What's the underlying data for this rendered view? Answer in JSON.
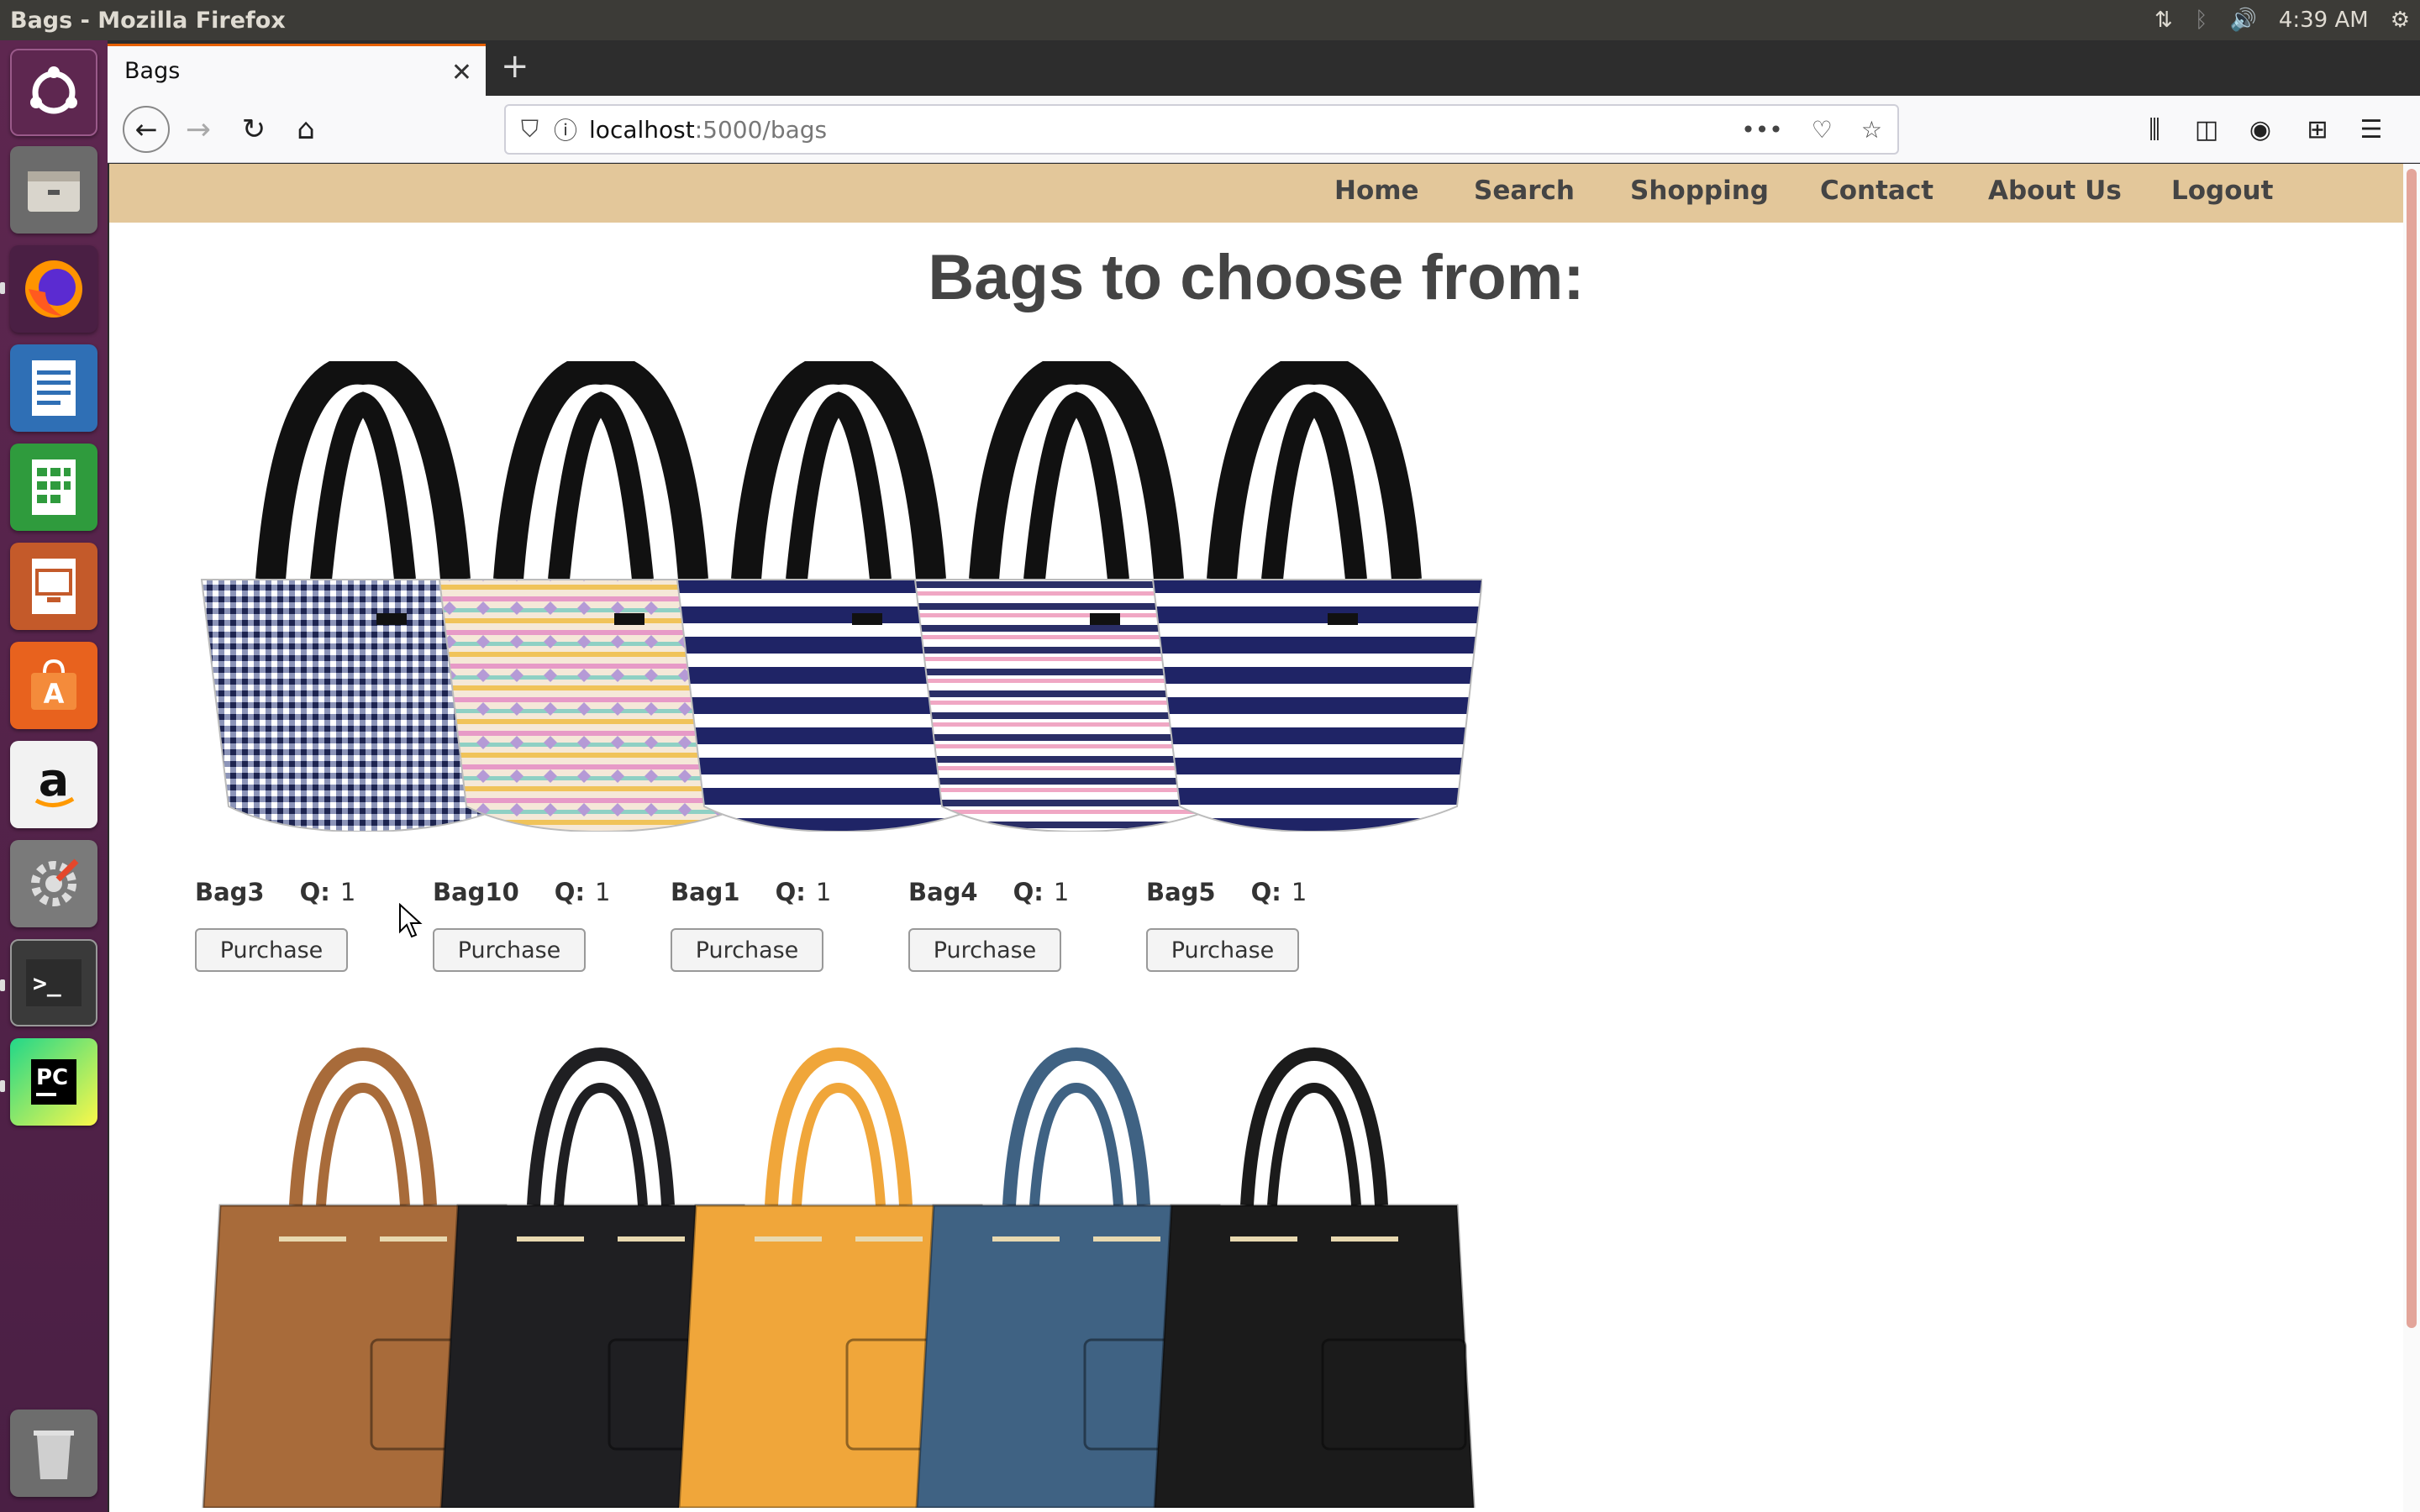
{
  "window_title": "Bags - Mozilla Firefox",
  "system_tray": {
    "time": "4:39 AM"
  },
  "browser": {
    "tab_title": "Bags",
    "url_host": "localhost",
    "url_path": ":5000/bags"
  },
  "site_nav": {
    "items": [
      "Home",
      "Search",
      "Shopping",
      "Contact",
      "About Us",
      "Logout"
    ]
  },
  "page": {
    "heading": "Bags to choose from:",
    "purchase_label": "Purchase",
    "qty_prefix": "Q:",
    "products": [
      {
        "name": "Bag3",
        "qty": "1",
        "pattern": "gingham"
      },
      {
        "name": "Bag10",
        "qty": "1",
        "pattern": "aztec"
      },
      {
        "name": "Bag1",
        "qty": "1",
        "pattern": "navy-stripe"
      },
      {
        "name": "Bag4",
        "qty": "1",
        "pattern": "pink-stripe"
      },
      {
        "name": "Bag5",
        "qty": "1",
        "pattern": "navy-stripe"
      }
    ],
    "second_row_bags": [
      {
        "color": "#a86b3a"
      },
      {
        "color": "#1f1f22"
      },
      {
        "color": "#f0a63a"
      },
      {
        "color": "#3f6283"
      },
      {
        "color": "#1b1b1b"
      }
    ]
  },
  "colors": {
    "site_nav_bg": "#e3c79a",
    "launcher_bg": "#5e2750",
    "tab_accent": "#e66000"
  }
}
